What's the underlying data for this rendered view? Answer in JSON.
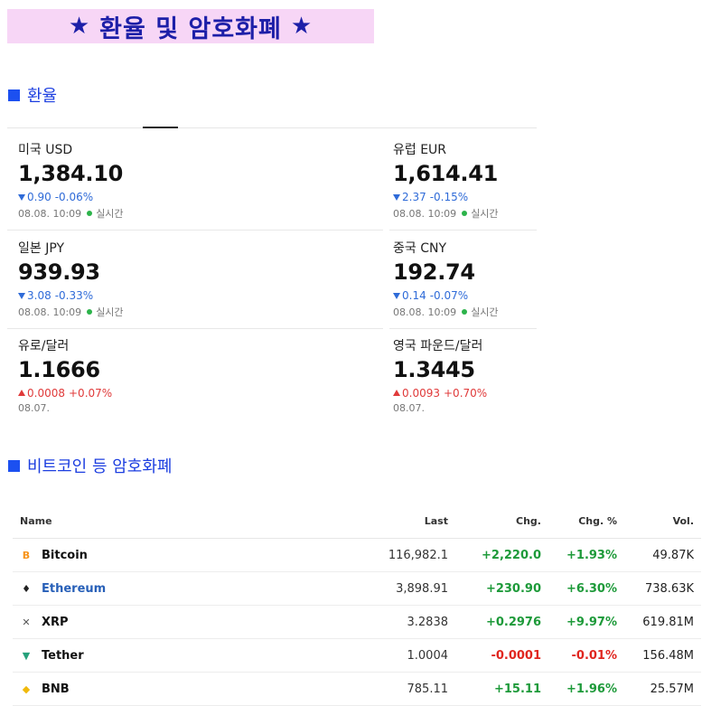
{
  "banner": {
    "title": "환율 및 암호화폐",
    "star": "★"
  },
  "fx_section": {
    "title": "환율"
  },
  "crypto_section": {
    "title": "비트코인 등 암호화폐"
  },
  "colors": {
    "banner_bg": "#f7d6f6",
    "banner_text": "#1d1fa8",
    "section_blue": "#1c50f0",
    "down": "#2f6bd8",
    "up": "#e03a3a",
    "positive": "#1e9a3a",
    "negative": "#e0261f",
    "live_dot": "#2cb34a"
  },
  "fx": [
    {
      "name": "미국 USD",
      "value": "1,384.10",
      "direction": "down",
      "change": "0.90",
      "pct": "-0.06%",
      "time": "08.08. 10:09",
      "live": "실시간"
    },
    {
      "name": "유럽 EUR",
      "value": "1,614.41",
      "direction": "down",
      "change": "2.37",
      "pct": "-0.15%",
      "time": "08.08. 10:09",
      "live": "실시간"
    },
    {
      "name": "일본 JPY",
      "value": "939.93",
      "direction": "down",
      "change": "3.08",
      "pct": "-0.33%",
      "time": "08.08. 10:09",
      "live": "실시간"
    },
    {
      "name": "중국 CNY",
      "value": "192.74",
      "direction": "down",
      "change": "0.14",
      "pct": "-0.07%",
      "time": "08.08. 10:09",
      "live": "실시간"
    },
    {
      "name": "유로/달러",
      "value": "1.1666",
      "direction": "up",
      "change": "0.0008",
      "pct": "+0.07%",
      "time": "08.07.",
      "live": ""
    },
    {
      "name": "영국 파운드/달러",
      "value": "1.3445",
      "direction": "up",
      "change": "0.0093",
      "pct": "+0.70%",
      "time": "08.07.",
      "live": ""
    }
  ],
  "crypto": {
    "headers": {
      "name": "Name",
      "last": "Last",
      "chg": "Chg.",
      "chg_pct": "Chg. %",
      "vol": "Vol."
    },
    "rows": [
      {
        "name": "Bitcoin",
        "icon": "bitcoin-icon",
        "glyph": "B",
        "icon_color": "#f7931a",
        "last": "116,982.1",
        "chg": "+2,220.0",
        "chg_pct": "+1.93%",
        "vol": "49.87K",
        "sign": "pos",
        "link": false
      },
      {
        "name": "Ethereum",
        "icon": "ethereum-icon",
        "glyph": "♦",
        "icon_color": "#222222",
        "last": "3,898.91",
        "chg": "+230.90",
        "chg_pct": "+6.30%",
        "vol": "738.63K",
        "sign": "pos",
        "link": true
      },
      {
        "name": "XRP",
        "icon": "xrp-icon",
        "glyph": "✕",
        "icon_color": "#555555",
        "last": "3.2838",
        "chg": "+0.2976",
        "chg_pct": "+9.97%",
        "vol": "619.81M",
        "sign": "pos",
        "link": false
      },
      {
        "name": "Tether",
        "icon": "tether-icon",
        "glyph": "▼",
        "icon_color": "#26a17b",
        "last": "1.0004",
        "chg": "-0.0001",
        "chg_pct": "-0.01%",
        "vol": "156.48M",
        "sign": "neg",
        "link": false
      },
      {
        "name": "BNB",
        "icon": "bnb-icon",
        "glyph": "◆",
        "icon_color": "#f0b90b",
        "last": "785.11",
        "chg": "+15.11",
        "chg_pct": "+1.96%",
        "vol": "25.57M",
        "sign": "pos",
        "link": false
      }
    ]
  }
}
